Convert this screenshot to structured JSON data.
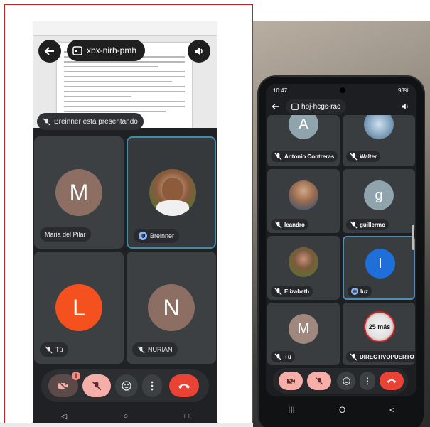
{
  "left": {
    "meeting_code": "xbx-nirh-pmh",
    "presenting_label": "Breinner está presentando",
    "tiles": [
      {
        "initial": "M",
        "name": "Maria del Pilar",
        "avatar_color": "#8d6e63",
        "muted": false,
        "active": false
      },
      {
        "initial": "",
        "name": "Breinner",
        "avatar_color": "#9e9e9e",
        "muted": false,
        "active": true
      },
      {
        "initial": "L",
        "name": "Tú",
        "avatar_color": "#f4511e",
        "muted": true,
        "active": false
      },
      {
        "initial": "N",
        "name": "NURIAN",
        "avatar_color": "#8d6e63",
        "muted": true,
        "active": false
      }
    ],
    "controls": [
      "camera-off",
      "mic-off",
      "reactions",
      "more",
      "end-call"
    ],
    "nav": {
      "back": "◁",
      "home": "○",
      "recents": "□"
    }
  },
  "right": {
    "status_time": "10:47",
    "status_battery": "93%",
    "meeting_code": "hpj-hcgs-rac",
    "tiles": [
      {
        "initial": "A",
        "name": "Antonio Contreras",
        "avatar_color": "#90a4ae"
      },
      {
        "initial": "",
        "name": "Walter",
        "avatar_color": "#7a9cb8"
      },
      {
        "initial": "",
        "name": "leandro",
        "avatar_color": "#5d7f9e"
      },
      {
        "initial": "g",
        "name": "guillermo",
        "avatar_color": "#90a4ae"
      },
      {
        "initial": "",
        "name": "Elizabeth",
        "avatar_color": "#6d8c5a"
      },
      {
        "initial": "I",
        "name": "luz",
        "avatar_color": "#1e6fd9"
      },
      {
        "initial": "M",
        "name": "Tú",
        "avatar_color": "#a1887f"
      },
      {
        "initial": "",
        "name": "DIRECTIVOPUERTO",
        "avatar_color": "#e0e0e0"
      }
    ],
    "badge_text": "25 más",
    "nav": {
      "recents": "III",
      "home": "O",
      "back": "<"
    }
  },
  "colors": {
    "end_call": "#ea4335",
    "mute_bg": "#f6aea9",
    "accent": "#3e8ea5"
  }
}
